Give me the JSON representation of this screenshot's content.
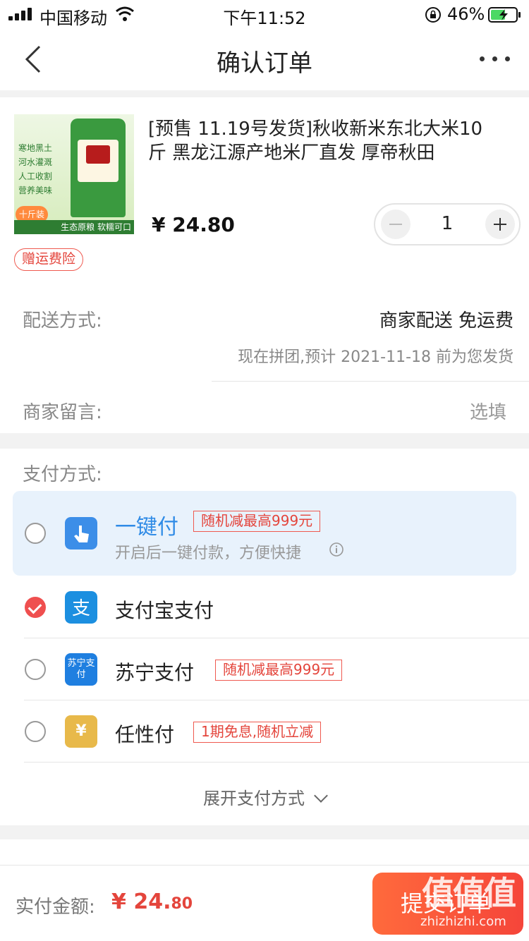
{
  "status_bar": {
    "carrier": "中国移动",
    "time": "下午11:52",
    "battery_percent": "46%"
  },
  "nav": {
    "title": "确认订单"
  },
  "product": {
    "name": "[预售 11.19号发货]秋收新米东北大米10斤 黑龙江源产地米厂直发 厚帝秋田",
    "price": "¥ 24.80",
    "quantity": "1",
    "insurance_badge": "赠运费险",
    "image_text": {
      "side": [
        "寒地黑土",
        "河水灌溉",
        "人工收割",
        "营养美味"
      ],
      "tag": "十斤装",
      "bottom": "生态原粮 软糯可口"
    }
  },
  "delivery": {
    "method_label": "配送方式:",
    "method_value": "商家配送 免运费",
    "method_note": "现在拼团,预计 2021-11-18 前为您发货",
    "message_label": "商家留言:",
    "message_placeholder": "选填"
  },
  "payment": {
    "section_title": "支付方式:",
    "options": [
      {
        "label": "一键付",
        "promo": "随机减最高999元",
        "sub": "开启后一键付款，方便快捷",
        "checked": false,
        "icon": "hand-tap-icon",
        "highlight": true
      },
      {
        "label": "支付宝支付",
        "promo": "",
        "sub": "",
        "checked": true,
        "icon": "alipay-icon"
      },
      {
        "label": "苏宁支付",
        "promo": "随机减最高999元",
        "sub": "",
        "checked": false,
        "icon": "suning-pay-icon",
        "icon_text": "苏宁支付"
      },
      {
        "label": "任性付",
        "promo": "1期免息,随机立减",
        "sub": "",
        "checked": false,
        "icon": "renxingfu-icon",
        "icon_text": "¥"
      }
    ],
    "expand_label": "展开支付方式"
  },
  "bottom": {
    "total_label": "实付金额:",
    "total_main": "¥ 24.",
    "total_cents": "80",
    "submit_label": "提交订单",
    "watermark": "zhizhizhi.com",
    "watermark_mark": "值值值"
  },
  "colors": {
    "accent_red": "#ef4f4f",
    "promo_red": "#e4453c",
    "highlight_blue": "#e8f2fc",
    "brand_blue": "#2f8be6"
  }
}
